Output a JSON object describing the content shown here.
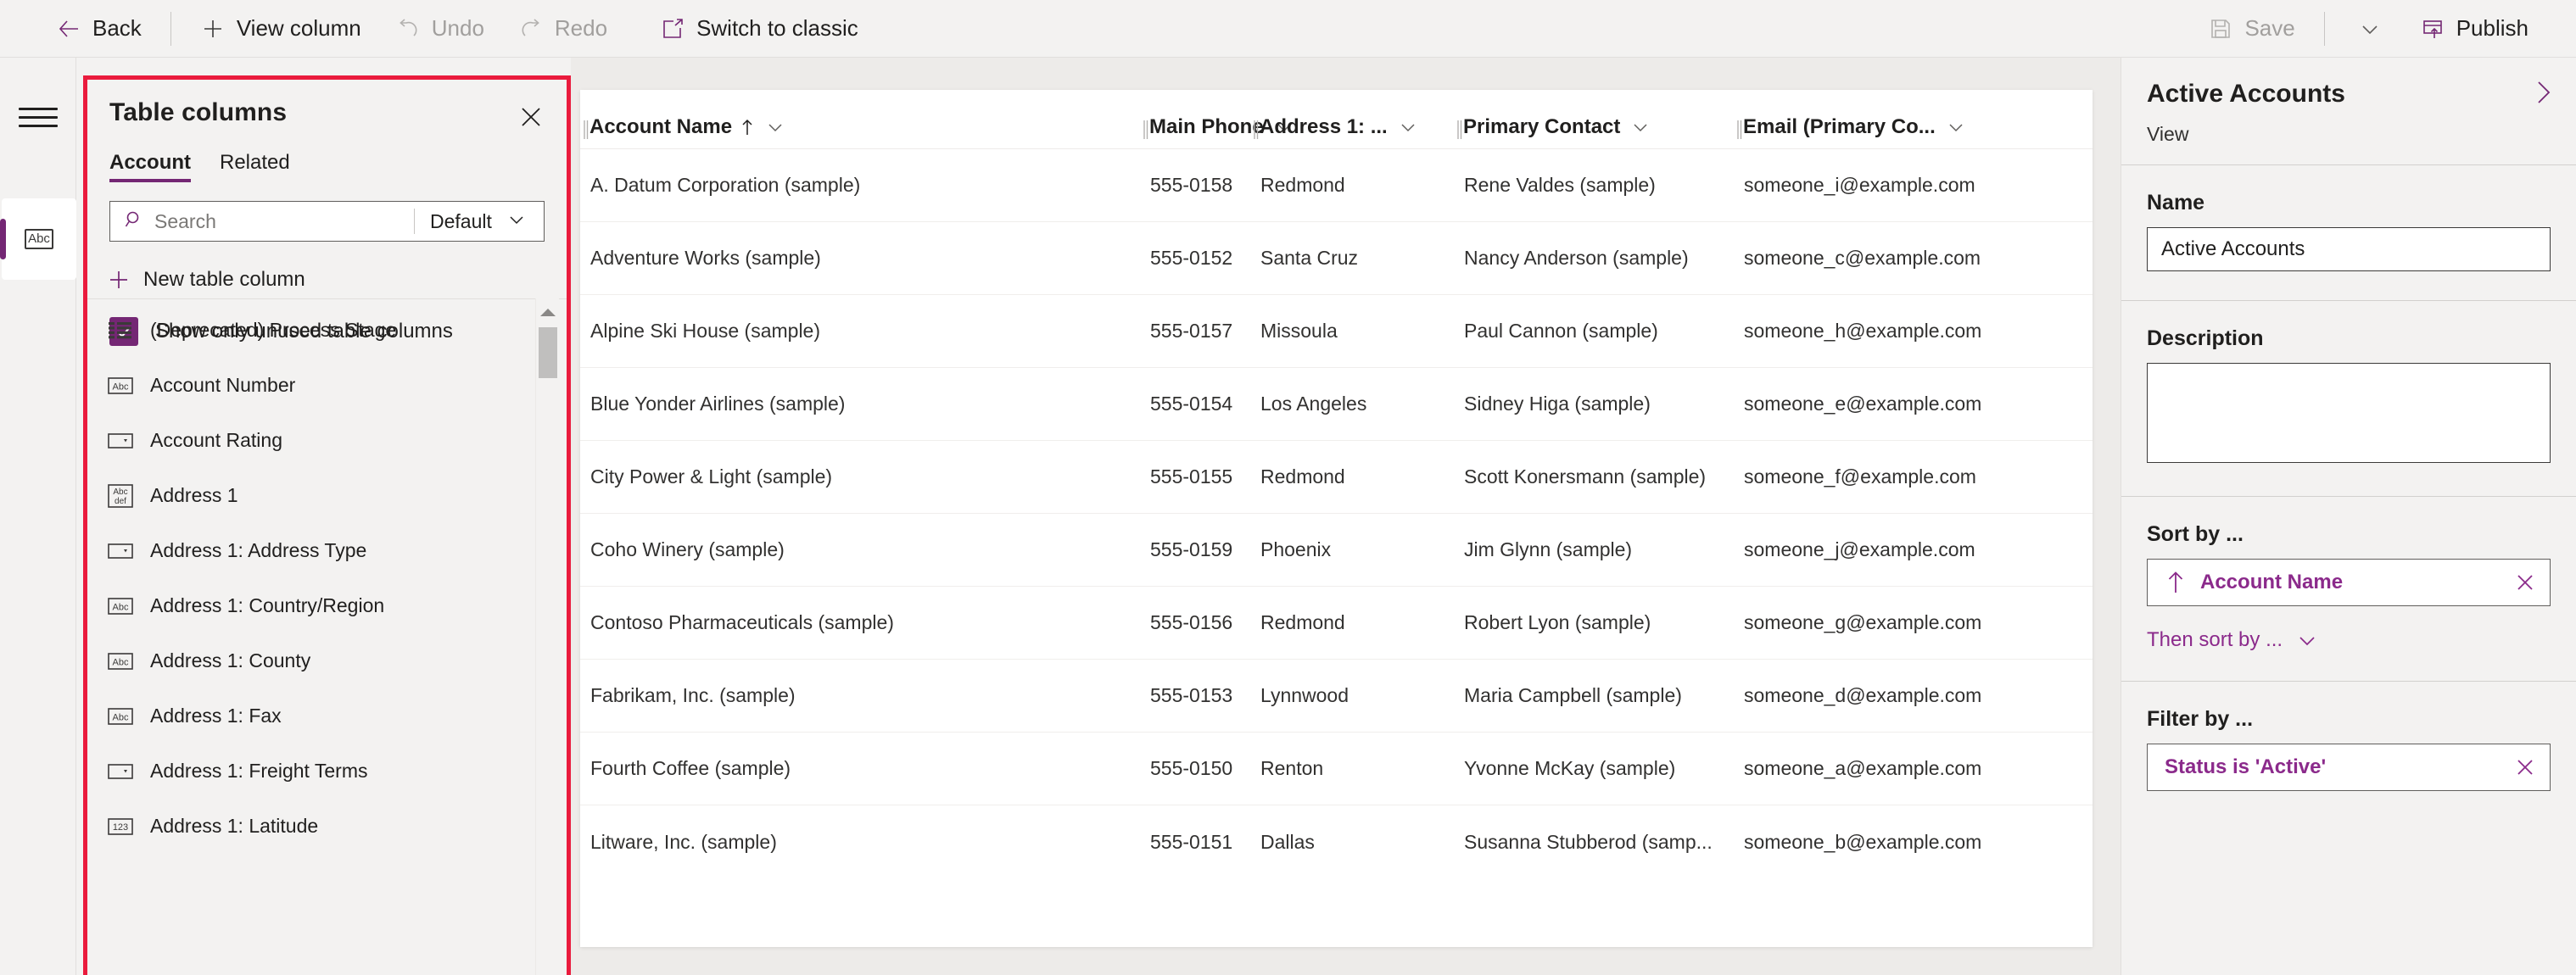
{
  "commandbar": {
    "left_items": [
      {
        "label": "Back",
        "icon": "arrow-left-icon",
        "enabled": true
      },
      {
        "label": "View column",
        "icon": "plus-icon",
        "enabled": true
      },
      {
        "label": "Undo",
        "icon": "undo-icon",
        "enabled": false
      },
      {
        "label": "Redo",
        "icon": "redo-icon",
        "enabled": false
      },
      {
        "label": "Switch to classic",
        "icon": "open-external-icon",
        "enabled": true
      }
    ],
    "right_items": [
      {
        "label": "Save",
        "icon": "save-icon",
        "enabled": false
      },
      {
        "label": "Publish",
        "icon": "publish-icon",
        "enabled": true
      }
    ],
    "overflow_caret": "chevron-down-icon"
  },
  "leftrail": {
    "hamburger": "hamburger-icon",
    "selected_item": {
      "name": "table-columns",
      "icon_text": "Abc"
    }
  },
  "table_columns_panel": {
    "title": "Table columns",
    "close_icon": "close-icon",
    "highlight_color": "#ea1b3d",
    "tabs": [
      {
        "label": "Account",
        "active": true
      },
      {
        "label": "Related",
        "active": false
      }
    ],
    "search": {
      "placeholder": "Search",
      "value": "",
      "icon": "search-icon"
    },
    "scope": {
      "value": "Default",
      "caret": "chevron-down-icon"
    },
    "new_column": {
      "label": "New table column",
      "icon": "plus-icon"
    },
    "show_unused": {
      "label": "Show only unused table columns",
      "checked": true
    },
    "scrollbar": {
      "up_arrow": "caret-up-icon",
      "thumb_position": "top"
    },
    "columns": [
      {
        "label": "(Deprecated) Process Stage",
        "type": "multiselect"
      },
      {
        "label": "Account Number",
        "type": "text"
      },
      {
        "label": "Account Rating",
        "type": "choice"
      },
      {
        "label": "Address 1",
        "type": "multiline"
      },
      {
        "label": "Address 1: Address Type",
        "type": "choice"
      },
      {
        "label": "Address 1: Country/Region",
        "type": "text"
      },
      {
        "label": "Address 1: County",
        "type": "text"
      },
      {
        "label": "Address 1: Fax",
        "type": "text"
      },
      {
        "label": "Address 1: Freight Terms",
        "type": "choice"
      },
      {
        "label": "Address 1: Latitude",
        "type": "number"
      }
    ]
  },
  "grid": {
    "columns": [
      {
        "label": "Account Name",
        "sorted": true,
        "sort_dir": "asc",
        "caret": "chevron-down-icon",
        "width_class": "c0"
      },
      {
        "label": "Main Phone",
        "sorted": false,
        "caret": "chevron-down-icon",
        "width_class": "c1"
      },
      {
        "label": "Address 1: ...",
        "sorted": false,
        "caret": "chevron-down-icon",
        "width_class": "c2"
      },
      {
        "label": "Primary Contact",
        "sorted": false,
        "caret": "chevron-down-icon",
        "width_class": "c3"
      },
      {
        "label": "Email (Primary Co...",
        "sorted": false,
        "caret": "chevron-down-icon",
        "width_class": "c4"
      }
    ],
    "rows": [
      [
        "A. Datum Corporation (sample)",
        "555-0158",
        "Redmond",
        "Rene Valdes (sample)",
        "someone_i@example.com"
      ],
      [
        "Adventure Works (sample)",
        "555-0152",
        "Santa Cruz",
        "Nancy Anderson (sample)",
        "someone_c@example.com"
      ],
      [
        "Alpine Ski House (sample)",
        "555-0157",
        "Missoula",
        "Paul Cannon (sample)",
        "someone_h@example.com"
      ],
      [
        "Blue Yonder Airlines (sample)",
        "555-0154",
        "Los Angeles",
        "Sidney Higa (sample)",
        "someone_e@example.com"
      ],
      [
        "City Power & Light (sample)",
        "555-0155",
        "Redmond",
        "Scott Konersmann (sample)",
        "someone_f@example.com"
      ],
      [
        "Coho Winery (sample)",
        "555-0159",
        "Phoenix",
        "Jim Glynn (sample)",
        "someone_j@example.com"
      ],
      [
        "Contoso Pharmaceuticals (sample)",
        "555-0156",
        "Redmond",
        "Robert Lyon (sample)",
        "someone_g@example.com"
      ],
      [
        "Fabrikam, Inc. (sample)",
        "555-0153",
        "Lynnwood",
        "Maria Campbell (sample)",
        "someone_d@example.com"
      ],
      [
        "Fourth Coffee (sample)",
        "555-0150",
        "Renton",
        "Yvonne McKay (sample)",
        "someone_a@example.com"
      ],
      [
        "Litware, Inc. (sample)",
        "555-0151",
        "Dallas",
        "Susanna Stubberod (samp...",
        "someone_b@example.com"
      ]
    ]
  },
  "properties": {
    "title": "Active Accounts",
    "subtitle": "View",
    "expand_icon": "chevron-right-icon",
    "name": {
      "label": "Name",
      "value": "Active Accounts"
    },
    "description": {
      "label": "Description",
      "value": ""
    },
    "sort_by": {
      "label": "Sort by ...",
      "chip": {
        "text": "Account Name",
        "direction_icon": "arrow-up-icon",
        "remove_icon": "close-icon"
      },
      "then_sort_by": {
        "label": "Then sort by ...",
        "caret": "chevron-down-icon"
      }
    },
    "filter_by": {
      "label": "Filter by ...",
      "chip": {
        "text": "Status is 'Active'",
        "remove_icon": "close-icon"
      }
    },
    "accent_color": "#8B2A8B"
  }
}
